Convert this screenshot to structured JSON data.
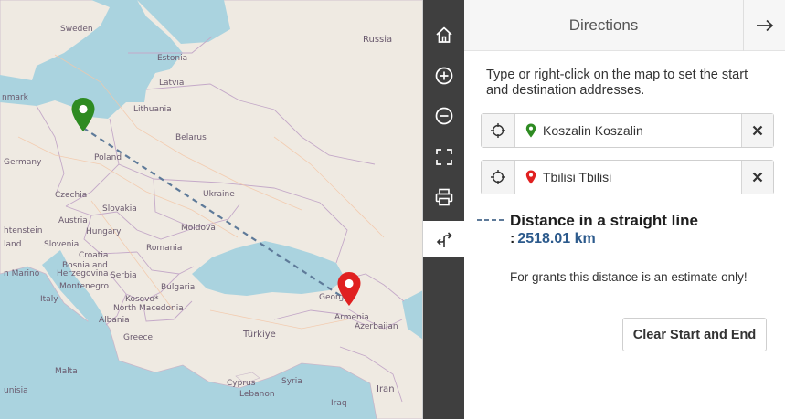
{
  "map": {
    "labels": {
      "sweden": "Sweden",
      "russia": "Russia",
      "estonia": "Estonia",
      "latvia": "Latvia",
      "denmark": "nmark",
      "lithuania": "Lithuania",
      "belarus": "Belarus",
      "germany": "Germany",
      "poland": "Poland",
      "czechia": "Czechia",
      "ukraine": "Ukraine",
      "slovakia": "Slovakia",
      "austria": "Austria",
      "liechtenstein": "htenstein",
      "hungary": "Hungary",
      "moldova": "Moldova",
      "slovenia": "Slovenia",
      "switzerland": "land",
      "croatia": "Croatia",
      "romania": "Romania",
      "bosnia_line1": "Bosnia and",
      "bosnia_line2": "Herzegovina",
      "san_marino": "n Marino",
      "serbia": "Serbia",
      "montenegro": "Montenegro",
      "bulgaria": "Bulgaria",
      "italy": "Italy",
      "kosovo": "Kosovo*",
      "north_macedonia": "North Macedonia",
      "albania": "Albania",
      "georgia": "Georgia",
      "armenia": "Armenia",
      "azerbaijan": "Azerbaijan",
      "greece": "Greece",
      "turkiye": "Türkiye",
      "malta": "Malta",
      "cyprus": "Cyprus",
      "syria": "Syria",
      "lebanon": "Lebanon",
      "tunisia": "unisia",
      "iran": "Iran",
      "iraq": "Iraq"
    },
    "start_pin_color": "#2e8b22",
    "end_pin_color": "#e02020",
    "route_color": "#5e7a99"
  },
  "toolbar": {
    "home_icon": "home-icon",
    "zoom_in_icon": "zoom-in-icon",
    "zoom_out_icon": "zoom-out-icon",
    "fullscreen_icon": "fullscreen-icon",
    "print_icon": "print-icon",
    "directions_icon": "directions-icon",
    "background": "#3f3f3f"
  },
  "panel": {
    "title": "Directions",
    "collapse_icon": "arrow-right-icon",
    "instructions": "Type or right-click on the map to set the start and destination addresses.",
    "start": {
      "value": "Koszalin  Koszalin",
      "marker_color": "#2e8b22"
    },
    "destination": {
      "value": "Tbilisi  Tbilisi",
      "marker_color": "#e02020"
    },
    "result": {
      "title": "Distance in a straight line",
      "colon": ":",
      "distance": "2518.01 km",
      "note": "For grants this distance is an estimate only!"
    },
    "clear_button": "Clear Start and End",
    "accent_color": "#2c5a8c"
  }
}
